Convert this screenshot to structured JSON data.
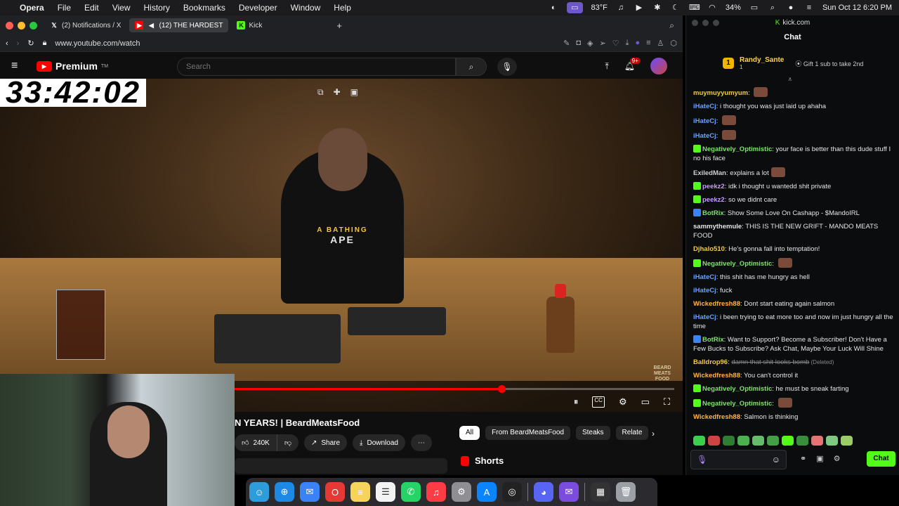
{
  "menubar": {
    "app": "Opera",
    "items": [
      "File",
      "Edit",
      "View",
      "History",
      "Bookmarks",
      "Developer",
      "Window",
      "Help"
    ],
    "temperature": "83°F",
    "battery": "34%",
    "clock": "Sun Oct 12  6:20 PM"
  },
  "tabs": [
    {
      "label": "(2) Notifications / X",
      "icon": "x-logo-icon"
    },
    {
      "label": "(12) THE HARDEST",
      "icon": "youtube-icon"
    },
    {
      "label": "Kick",
      "icon": "kick-icon"
    }
  ],
  "address": {
    "url": "www.youtube.com/watch"
  },
  "youtube": {
    "logo": "Premium",
    "search_placeholder": "Search",
    "notification_count": "9+"
  },
  "timer": "33:42:02",
  "video": {
    "shirt_text_top": "A BATHING",
    "shirt_text_bottom": "APE",
    "watermark": "BEARD MEATS FOOD",
    "progress": 0.61
  },
  "below_video": {
    "title": "N YEARS! | BeardMeatsFood",
    "like_count": "240K",
    "share_label": "Share",
    "download_label": "Download",
    "chips": [
      "All",
      "From BeardMeatsFood",
      "Steaks",
      "Relate"
    ],
    "shorts_label": "Shorts"
  },
  "chat": {
    "window_title": "kick.com",
    "header": "Chat",
    "pinned": {
      "rank": "1",
      "user": "Randy_Sante",
      "count": "1",
      "gift_text": "Gift 1 sub to take 2nd"
    },
    "messages": [
      {
        "user": "muymuyyumyum",
        "color": "#f2c94c",
        "text": "",
        "emote": true
      },
      {
        "user": "iHateCj",
        "color": "#6aa3ff",
        "text": "i thought you was just laid up ahaha"
      },
      {
        "user": "iHateCj",
        "color": "#6aa3ff",
        "text": "",
        "emote": true
      },
      {
        "user": "iHateCj",
        "color": "#6aa3ff",
        "text": "",
        "emote": true
      },
      {
        "user": "Negatively_Optimistic",
        "color": "#7ee36a",
        "text": "your face is better than this dude stuff I no his face",
        "badge": "#53fc18"
      },
      {
        "user": "ExiledMan",
        "color": "#cfcfcf",
        "text": "explains a lot",
        "emote": true
      },
      {
        "user": "peekz2",
        "color": "#c79bff",
        "text": "idk i thought u wantedd shit private",
        "badge": "#53fc18"
      },
      {
        "user": "peekz2",
        "color": "#c79bff",
        "text": "so we didnt care",
        "badge": "#53fc18"
      },
      {
        "user": "BotRix",
        "color": "#7ee36a",
        "text": "Show Some Love On Cashapp - $MandoIRL",
        "badge": "#3b82f6"
      },
      {
        "user": "sammythemule",
        "color": "#e6e6e6",
        "text": "THIS IS THE NEW GRIFT - MANDO MEATS FOOD"
      },
      {
        "user": "Djhalo510",
        "color": "#f2c94c",
        "text": "He's gonna fall into temptation!"
      },
      {
        "user": "Negatively_Optimistic",
        "color": "#7ee36a",
        "text": "",
        "badge": "#53fc18",
        "emote": true
      },
      {
        "user": "iHateCj",
        "color": "#6aa3ff",
        "text": "this shit has me hungry as hell"
      },
      {
        "user": "iHateCj",
        "color": "#6aa3ff",
        "text": "fuck"
      },
      {
        "user": "Wickedfresh88",
        "color": "#ffb347",
        "text": "Dont start eating again salmon"
      },
      {
        "user": "iHateCj",
        "color": "#6aa3ff",
        "text": "i been trying to eat more too and now im just hungry all the time"
      },
      {
        "user": "BotRix",
        "color": "#7ee36a",
        "text": "Want to Support? Become a Subscriber! Don't Have a Few Bucks to Subscribe? Ask Chat, Maybe Your Luck Will Shine",
        "badge": "#3b82f6"
      },
      {
        "user": "Balldrop96",
        "color": "#f2c94c",
        "text": "damn that shit looks bomb",
        "deleted": "(Deleted)"
      },
      {
        "user": "Wickedfresh88",
        "color": "#ffb347",
        "text": "You can't control it"
      },
      {
        "user": "Negatively_Optimistic",
        "color": "#7ee36a",
        "text": "he must be sneak farting",
        "badge": "#53fc18"
      },
      {
        "user": "Negatively_Optimistic",
        "color": "#7ee36a",
        "text": "",
        "badge": "#53fc18",
        "emote": true
      },
      {
        "user": "Wickedfresh88",
        "color": "#ffb347",
        "text": "Salmon is thinking"
      }
    ],
    "send_label": "Chat",
    "accent": "#53fc18"
  },
  "dock": [
    "Finder",
    "Safari",
    "Mail",
    "Opera",
    "Notes",
    "Reminders",
    "WhatsApp",
    "Music",
    "Settings",
    "App Store",
    "Activity",
    "Discord",
    "Mail2",
    "Screenshot",
    "Trash"
  ]
}
